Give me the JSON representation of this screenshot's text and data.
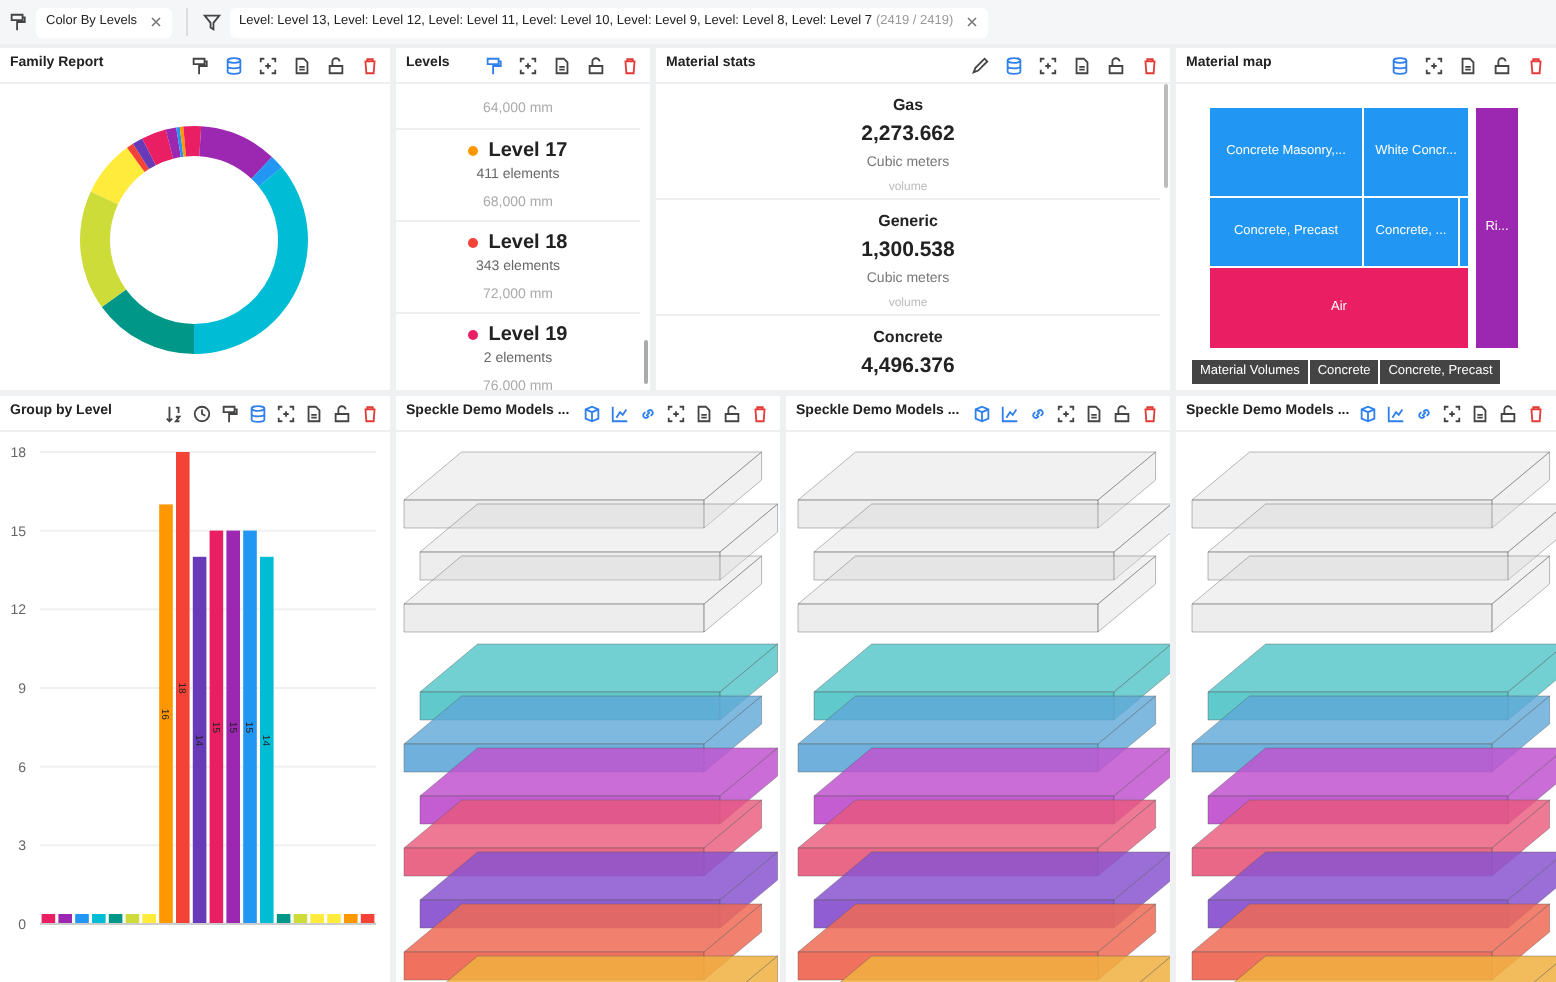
{
  "filter_bar": {
    "chips": [
      {
        "kind": "color",
        "label": "Color By Levels"
      },
      {
        "kind": "filter",
        "label": "Level: Level 13, Level: Level 12, Level: Level 11, Level: Level 10, Level: Level 9, Level: Level 8, Level: Level 7",
        "count": "(2419 / 2419)"
      }
    ]
  },
  "family_report": {
    "title": "Family Report",
    "tools": [
      {
        "kind": "paint",
        "active": false
      },
      {
        "kind": "data",
        "active": true
      },
      {
        "kind": "focus",
        "active": false
      },
      {
        "kind": "file",
        "active": false
      },
      {
        "kind": "lock",
        "active": false
      },
      {
        "kind": "trash",
        "active": false
      }
    ]
  },
  "levels": {
    "title": "Levels",
    "tools": [
      {
        "kind": "paint",
        "active": true
      },
      {
        "kind": "focus",
        "active": false
      },
      {
        "kind": "file",
        "active": false
      },
      {
        "kind": "lock",
        "active": false
      },
      {
        "kind": "trash",
        "active": false
      }
    ],
    "items": [
      {
        "height": "64,000 mm"
      },
      {
        "name": "Level 17",
        "count": "411 elements",
        "height": "68,000 mm",
        "color": "#ff9800"
      },
      {
        "name": "Level 18",
        "count": "343 elements",
        "height": "72,000 mm",
        "color": "#f44336"
      },
      {
        "name": "Level 19",
        "count": "2 elements",
        "height": "76,000 mm",
        "color": "#e91e63"
      }
    ]
  },
  "material_stats": {
    "title": "Material stats",
    "tools": [
      {
        "kind": "pencil",
        "active": false
      },
      {
        "kind": "data",
        "active": true
      },
      {
        "kind": "focus",
        "active": false
      },
      {
        "kind": "file",
        "active": false
      },
      {
        "kind": "lock",
        "active": false
      },
      {
        "kind": "trash",
        "active": false
      }
    ],
    "items": [
      {
        "name": "Gas",
        "value": "2,273.662",
        "unit": "Cubic meters",
        "measure": "volume"
      },
      {
        "name": "Generic",
        "value": "1,300.538",
        "unit": "Cubic meters",
        "measure": "volume"
      },
      {
        "name": "Concrete",
        "value": "4,496.376"
      }
    ]
  },
  "material_map": {
    "title": "Material map",
    "tools": [
      {
        "kind": "data",
        "active": true
      },
      {
        "kind": "focus",
        "active": false
      },
      {
        "kind": "file",
        "active": false
      },
      {
        "kind": "lock",
        "active": false
      },
      {
        "kind": "trash",
        "active": false
      }
    ],
    "tiles": [
      {
        "label": "Concrete Masonry,...",
        "color": "#2196f3"
      },
      {
        "label": "White Concr...",
        "color": "#2196f3"
      },
      {
        "label": "Concrete, Precast",
        "color": "#2196f3"
      },
      {
        "label": "Concrete, ...",
        "color": "#2196f3"
      },
      {
        "label": "Air",
        "color": "#e91e63"
      },
      {
        "label": "Ri...",
        "color": "#9c27b0"
      }
    ],
    "breadcrumb": [
      "Material Volumes",
      "Concrete",
      "Concrete, Precast"
    ]
  },
  "group_by_level": {
    "title": "Group by Level",
    "tools": [
      {
        "kind": "sort",
        "active": false
      },
      {
        "kind": "clock",
        "active": false
      },
      {
        "kind": "paint",
        "active": false
      },
      {
        "kind": "data",
        "active": true
      },
      {
        "kind": "focus",
        "active": false
      },
      {
        "kind": "file",
        "active": false
      },
      {
        "kind": "lock",
        "active": false
      },
      {
        "kind": "trash",
        "active": false
      }
    ],
    "chart_data": {
      "type": "bar",
      "ylim": [
        0,
        18
      ],
      "yticks": [
        0,
        3,
        6,
        9,
        12,
        15,
        18
      ],
      "grid": true,
      "values": [
        0.3,
        0.3,
        0.3,
        0.3,
        0.3,
        0.3,
        0.3,
        16,
        18,
        14,
        15,
        15,
        15,
        14,
        0.3,
        0.3,
        0.3,
        0.3,
        0.3,
        0.3
      ],
      "value_labels": [
        null,
        null,
        null,
        null,
        null,
        null,
        null,
        "16",
        "18",
        "14",
        "15",
        "15",
        "15",
        "14",
        null,
        null,
        null,
        null,
        null,
        null
      ]
    }
  },
  "viewers": [
    {
      "title": "Speckle Demo Models ...",
      "tools": [
        {
          "kind": "cube",
          "active": true
        },
        {
          "kind": "chart",
          "active": true
        },
        {
          "kind": "link",
          "active": true
        },
        {
          "kind": "focus",
          "active": false
        },
        {
          "kind": "file",
          "active": false
        },
        {
          "kind": "lock",
          "active": false
        },
        {
          "kind": "trash",
          "active": false
        }
      ]
    },
    {
      "title": "Speckle Demo Models ...",
      "tools": [
        {
          "kind": "cube",
          "active": true
        },
        {
          "kind": "chart",
          "active": true
        },
        {
          "kind": "link",
          "active": true
        },
        {
          "kind": "focus",
          "active": false
        },
        {
          "kind": "file",
          "active": false
        },
        {
          "kind": "lock",
          "active": false
        },
        {
          "kind": "trash",
          "active": false
        }
      ]
    },
    {
      "title": "Speckle Demo Models ...",
      "tools": [
        {
          "kind": "cube",
          "active": true
        },
        {
          "kind": "chart",
          "active": true
        },
        {
          "kind": "link",
          "active": true
        },
        {
          "kind": "focus",
          "active": false
        },
        {
          "kind": "file",
          "active": false
        },
        {
          "kind": "lock",
          "active": false
        },
        {
          "kind": "trash",
          "active": false
        }
      ]
    }
  ]
}
